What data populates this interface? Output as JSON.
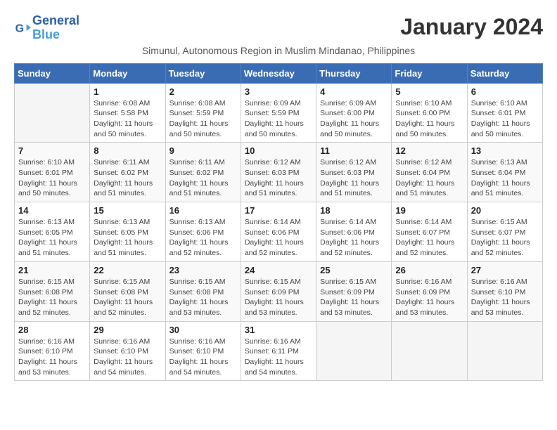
{
  "logo": {
    "general": "General",
    "blue": "Blue"
  },
  "title": "January 2024",
  "subtitle": "Simunul, Autonomous Region in Muslim Mindanao, Philippines",
  "days_of_week": [
    "Sunday",
    "Monday",
    "Tuesday",
    "Wednesday",
    "Thursday",
    "Friday",
    "Saturday"
  ],
  "weeks": [
    [
      {
        "day": "",
        "info": ""
      },
      {
        "day": "1",
        "info": "Sunrise: 6:08 AM\nSunset: 5:58 PM\nDaylight: 11 hours\nand 50 minutes."
      },
      {
        "day": "2",
        "info": "Sunrise: 6:08 AM\nSunset: 5:59 PM\nDaylight: 11 hours\nand 50 minutes."
      },
      {
        "day": "3",
        "info": "Sunrise: 6:09 AM\nSunset: 5:59 PM\nDaylight: 11 hours\nand 50 minutes."
      },
      {
        "day": "4",
        "info": "Sunrise: 6:09 AM\nSunset: 6:00 PM\nDaylight: 11 hours\nand 50 minutes."
      },
      {
        "day": "5",
        "info": "Sunrise: 6:10 AM\nSunset: 6:00 PM\nDaylight: 11 hours\nand 50 minutes."
      },
      {
        "day": "6",
        "info": "Sunrise: 6:10 AM\nSunset: 6:01 PM\nDaylight: 11 hours\nand 50 minutes."
      }
    ],
    [
      {
        "day": "7",
        "info": "Sunrise: 6:10 AM\nSunset: 6:01 PM\nDaylight: 11 hours\nand 50 minutes."
      },
      {
        "day": "8",
        "info": "Sunrise: 6:11 AM\nSunset: 6:02 PM\nDaylight: 11 hours\nand 51 minutes."
      },
      {
        "day": "9",
        "info": "Sunrise: 6:11 AM\nSunset: 6:02 PM\nDaylight: 11 hours\nand 51 minutes."
      },
      {
        "day": "10",
        "info": "Sunrise: 6:12 AM\nSunset: 6:03 PM\nDaylight: 11 hours\nand 51 minutes."
      },
      {
        "day": "11",
        "info": "Sunrise: 6:12 AM\nSunset: 6:03 PM\nDaylight: 11 hours\nand 51 minutes."
      },
      {
        "day": "12",
        "info": "Sunrise: 6:12 AM\nSunset: 6:04 PM\nDaylight: 11 hours\nand 51 minutes."
      },
      {
        "day": "13",
        "info": "Sunrise: 6:13 AM\nSunset: 6:04 PM\nDaylight: 11 hours\nand 51 minutes."
      }
    ],
    [
      {
        "day": "14",
        "info": "Sunrise: 6:13 AM\nSunset: 6:05 PM\nDaylight: 11 hours\nand 51 minutes."
      },
      {
        "day": "15",
        "info": "Sunrise: 6:13 AM\nSunset: 6:05 PM\nDaylight: 11 hours\nand 51 minutes."
      },
      {
        "day": "16",
        "info": "Sunrise: 6:13 AM\nSunset: 6:06 PM\nDaylight: 11 hours\nand 52 minutes."
      },
      {
        "day": "17",
        "info": "Sunrise: 6:14 AM\nSunset: 6:06 PM\nDaylight: 11 hours\nand 52 minutes."
      },
      {
        "day": "18",
        "info": "Sunrise: 6:14 AM\nSunset: 6:06 PM\nDaylight: 11 hours\nand 52 minutes."
      },
      {
        "day": "19",
        "info": "Sunrise: 6:14 AM\nSunset: 6:07 PM\nDaylight: 11 hours\nand 52 minutes."
      },
      {
        "day": "20",
        "info": "Sunrise: 6:15 AM\nSunset: 6:07 PM\nDaylight: 11 hours\nand 52 minutes."
      }
    ],
    [
      {
        "day": "21",
        "info": "Sunrise: 6:15 AM\nSunset: 6:08 PM\nDaylight: 11 hours\nand 52 minutes."
      },
      {
        "day": "22",
        "info": "Sunrise: 6:15 AM\nSunset: 6:08 PM\nDaylight: 11 hours\nand 52 minutes."
      },
      {
        "day": "23",
        "info": "Sunrise: 6:15 AM\nSunset: 6:08 PM\nDaylight: 11 hours\nand 53 minutes."
      },
      {
        "day": "24",
        "info": "Sunrise: 6:15 AM\nSunset: 6:09 PM\nDaylight: 11 hours\nand 53 minutes."
      },
      {
        "day": "25",
        "info": "Sunrise: 6:15 AM\nSunset: 6:09 PM\nDaylight: 11 hours\nand 53 minutes."
      },
      {
        "day": "26",
        "info": "Sunrise: 6:16 AM\nSunset: 6:09 PM\nDaylight: 11 hours\nand 53 minutes."
      },
      {
        "day": "27",
        "info": "Sunrise: 6:16 AM\nSunset: 6:10 PM\nDaylight: 11 hours\nand 53 minutes."
      }
    ],
    [
      {
        "day": "28",
        "info": "Sunrise: 6:16 AM\nSunset: 6:10 PM\nDaylight: 11 hours\nand 53 minutes."
      },
      {
        "day": "29",
        "info": "Sunrise: 6:16 AM\nSunset: 6:10 PM\nDaylight: 11 hours\nand 54 minutes."
      },
      {
        "day": "30",
        "info": "Sunrise: 6:16 AM\nSunset: 6:10 PM\nDaylight: 11 hours\nand 54 minutes."
      },
      {
        "day": "31",
        "info": "Sunrise: 6:16 AM\nSunset: 6:11 PM\nDaylight: 11 hours\nand 54 minutes."
      },
      {
        "day": "",
        "info": ""
      },
      {
        "day": "",
        "info": ""
      },
      {
        "day": "",
        "info": ""
      }
    ]
  ]
}
